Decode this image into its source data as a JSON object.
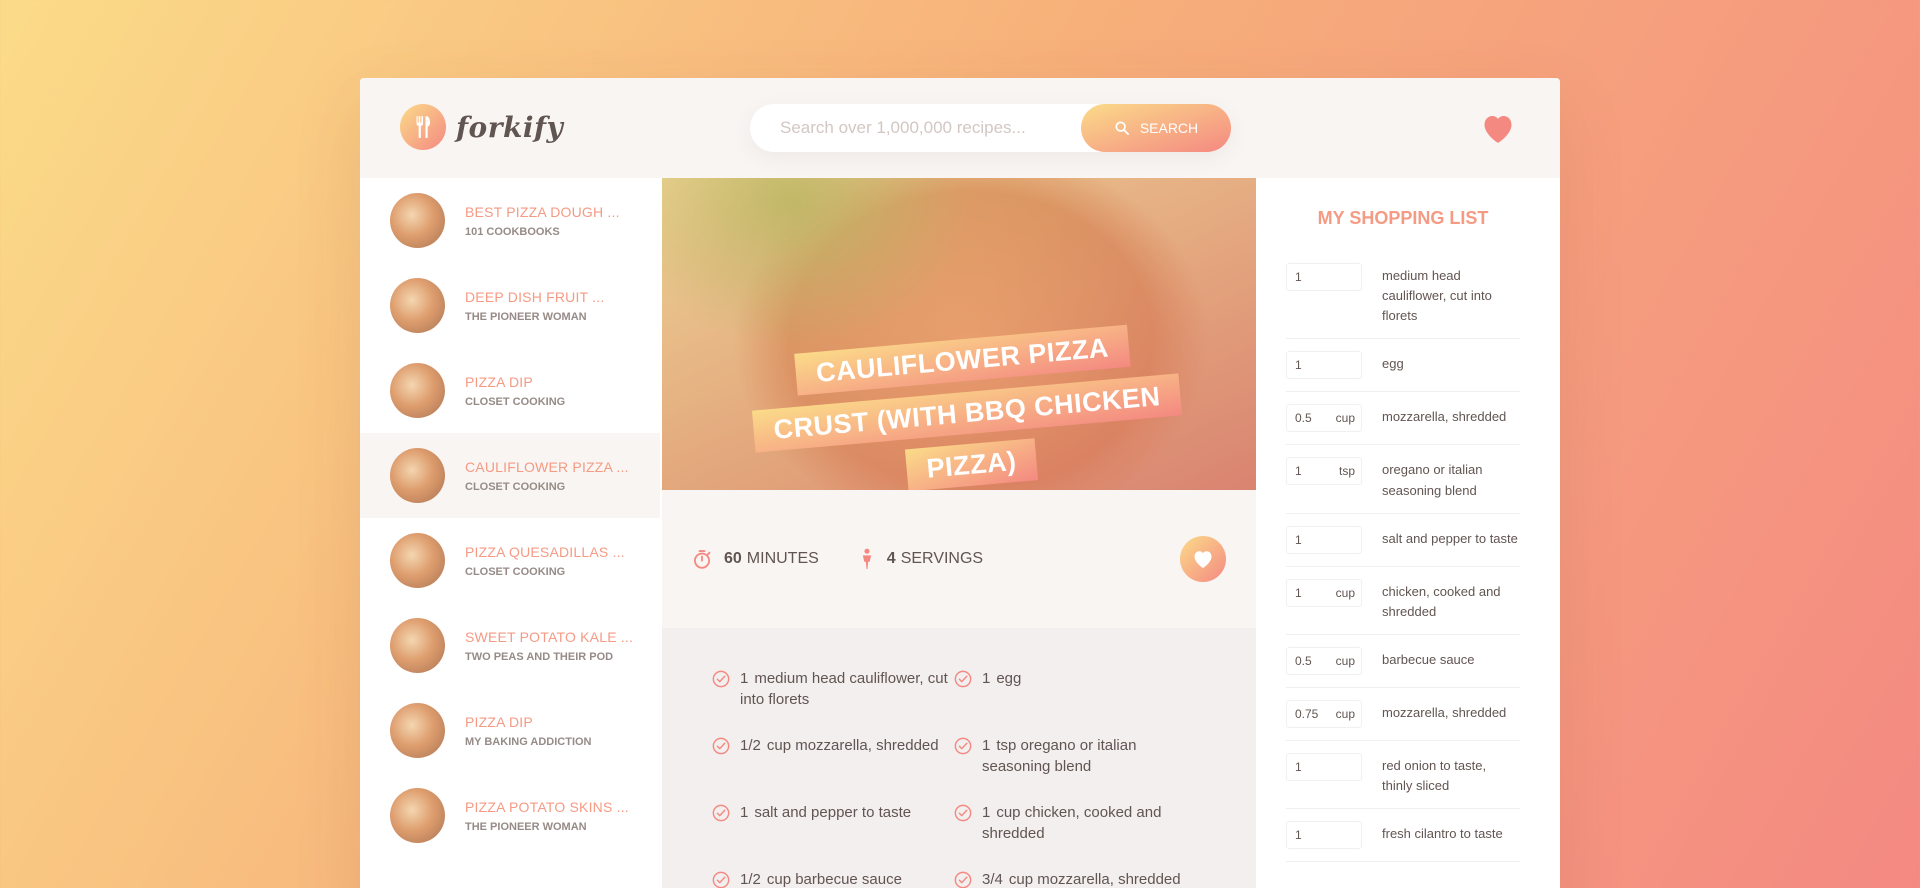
{
  "app": {
    "name": "forkify"
  },
  "search": {
    "placeholder": "Search over 1,000,000 recipes...",
    "button_label": "SEARCH"
  },
  "results": [
    {
      "title": "BEST PIZZA DOUGH ...",
      "author": "101 COOKBOOKS"
    },
    {
      "title": "DEEP DISH FRUIT ...",
      "author": "THE PIONEER WOMAN"
    },
    {
      "title": "PIZZA DIP",
      "author": "CLOSET COOKING"
    },
    {
      "title": "CAULIFLOWER PIZZA ...",
      "author": "CLOSET COOKING"
    },
    {
      "title": "PIZZA QUESADILLAS ...",
      "author": "CLOSET COOKING"
    },
    {
      "title": "SWEET POTATO KALE ...",
      "author": "TWO PEAS AND THEIR POD"
    },
    {
      "title": "PIZZA DIP",
      "author": "MY BAKING ADDICTION"
    },
    {
      "title": "PIZZA POTATO SKINS ...",
      "author": "THE PIONEER WOMAN"
    }
  ],
  "recipe": {
    "title_lines": [
      "CAULIFLOWER PIZZA",
      "CRUST (WITH BBQ CHICKEN",
      "PIZZA)"
    ],
    "time_value": "60",
    "time_unit": "MINUTES",
    "servings_value": "4",
    "servings_unit": "SERVINGS",
    "ingredients": [
      {
        "count": "1",
        "text": "medium head cauliflower, cut into florets"
      },
      {
        "count": "1",
        "text": "egg"
      },
      {
        "count": "1/2",
        "text": "cup mozzarella, shredded"
      },
      {
        "count": "1",
        "text": "tsp oregano or italian seasoning blend"
      },
      {
        "count": "1",
        "text": "salt and pepper to taste"
      },
      {
        "count": "1",
        "text": "cup chicken, cooked and shredded"
      },
      {
        "count": "1/2",
        "text": "cup barbecue sauce"
      },
      {
        "count": "3/4",
        "text": "cup mozzarella, shredded"
      }
    ]
  },
  "shopping": {
    "title": "MY SHOPPING LIST",
    "items": [
      {
        "count": "1",
        "unit": "",
        "text": "medium head cauliflower, cut into florets"
      },
      {
        "count": "1",
        "unit": "",
        "text": "egg"
      },
      {
        "count": "0.5",
        "unit": "cup",
        "text": "mozzarella, shredded"
      },
      {
        "count": "1",
        "unit": "tsp",
        "text": "oregano or italian seasoning blend"
      },
      {
        "count": "1",
        "unit": "",
        "text": "salt and pepper to taste"
      },
      {
        "count": "1",
        "unit": "cup",
        "text": "chicken, cooked and shredded"
      },
      {
        "count": "0.5",
        "unit": "cup",
        "text": "barbecue sauce"
      },
      {
        "count": "0.75",
        "unit": "cup",
        "text": "mozzarella, shredded"
      },
      {
        "count": "1",
        "unit": "",
        "text": "red onion to taste, thinly sliced"
      },
      {
        "count": "1",
        "unit": "",
        "text": "fresh cilantro to taste"
      }
    ]
  },
  "icons": {
    "logo": "fork-knife-icon",
    "search": "magnifier-icon",
    "likes": "heart-icon",
    "time": "stopwatch-icon",
    "servings": "person-icon",
    "ingredient": "check-circle-icon"
  },
  "colors": {
    "accent": "#f59a83",
    "accent_light": "#fbdb89",
    "accent_dark": "#f48982",
    "text": "#615551"
  }
}
